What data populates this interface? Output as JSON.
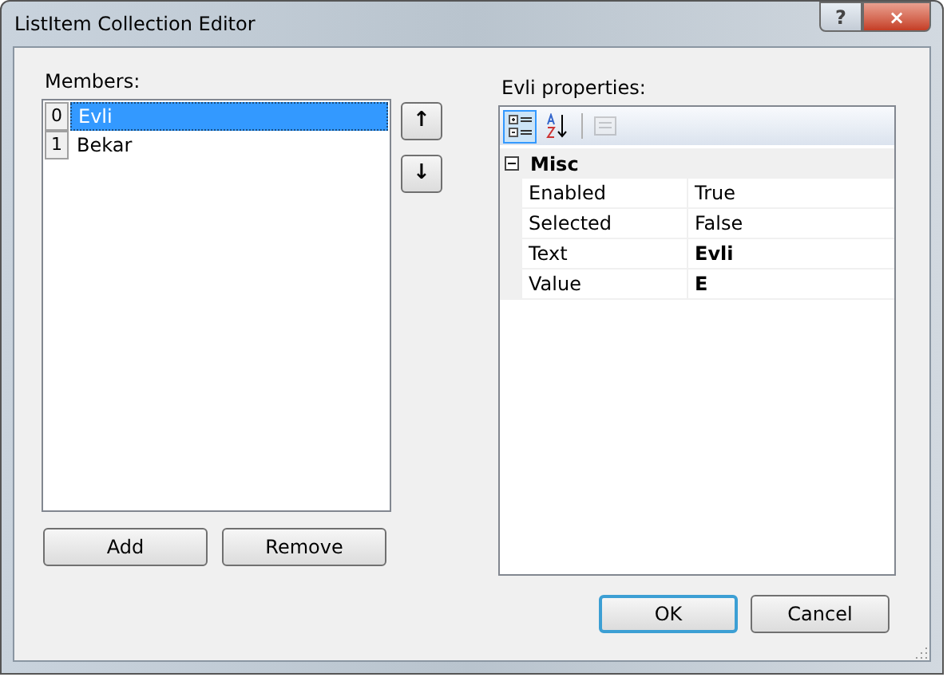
{
  "window": {
    "title": "ListItem Collection Editor",
    "buttons": [
      "?",
      "×"
    ]
  },
  "members": {
    "label": "Members:",
    "items": [
      {
        "index": "0",
        "text": "Evli",
        "selected": true
      },
      {
        "index": "1",
        "text": "Bekar",
        "selected": false
      }
    ],
    "move_buttons": [
      "↑",
      "↓"
    ],
    "buttons": [
      "Add",
      "Remove"
    ]
  },
  "properties": {
    "label": "Evli properties:",
    "toolbar": [
      {
        "kind": "categorized",
        "selected": true
      },
      {
        "kind": "alphabetical",
        "selected": false
      },
      {
        "kind": "pages",
        "disabled": true
      }
    ],
    "category": {
      "name": "Misc",
      "expanded": true
    },
    "rows": [
      {
        "name": "Enabled",
        "value": "True",
        "bold": false
      },
      {
        "name": "Selected",
        "value": "False",
        "bold": false
      },
      {
        "name": "Text",
        "value": "Evli",
        "bold": true
      },
      {
        "name": "Value",
        "value": "E",
        "bold": true
      }
    ]
  },
  "dialog_buttons": [
    {
      "label": "OK",
      "default": true
    },
    {
      "label": "Cancel",
      "default": false
    }
  ]
}
